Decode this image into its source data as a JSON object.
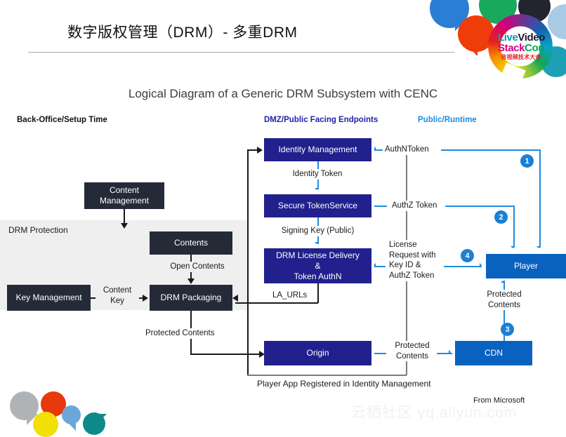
{
  "header": {
    "title": "数字版权管理（DRM）- 多重DRM",
    "bubble_icon": "speech-bubble-icon"
  },
  "logo": {
    "line1_a": "Live",
    "line1_b": "Video",
    "line2_a": "Stack",
    "line2_b": "Con",
    "subtitle": "音视频技术大会"
  },
  "diagram": {
    "title": "Logical Diagram of a Generic DRM Subsystem with CENC",
    "columns": [
      {
        "label": "Back-Office/Setup Time",
        "color": "#111111"
      },
      {
        "label": "DMZ/Public Facing Endpoints",
        "color": "#2222a8"
      },
      {
        "label": "Public/Runtime",
        "color": "#1f8ce0"
      }
    ],
    "panel_label": "DRM Protection",
    "nodes": {
      "content_management": "Content\nManagement",
      "contents": "Contents",
      "key_management": "Key Management",
      "drm_packaging": "DRM Packaging",
      "identity_management": "Identity Management",
      "secure_token_service": "Secure TokenService",
      "drm_license_delivery": "DRM License Delivery\n&\nTokenAuthN",
      "drm_license_delivery_l1": "DRM License Delivery",
      "drm_license_delivery_l2": "&",
      "drm_license_delivery_l3": "Token AuthN",
      "origin": "Origin",
      "cdn": "CDN",
      "player": "Player"
    },
    "edge_labels": {
      "open_contents": "Open Contents",
      "content_key": "Content\nKey",
      "protected_contents_left": "Protected  Contents",
      "identity_token": "Identity Token",
      "signing_key": "Signing Key (Public)",
      "la_urls": "LA_URLs",
      "authn_token": "AuthNToken",
      "authz_token": "AuthZ Token",
      "license_request": "License\nRequest with\nKey ID &\nAuthZ Token",
      "protected_contents_player": "Protected\nContents",
      "protected_contents_cdn": "Protected\nContents"
    },
    "badges": [
      "1",
      "2",
      "3",
      "4"
    ],
    "footnote": "Player App Registered in Identity Management",
    "credit": "From Microsoft"
  },
  "watermark": "云栖社区 yq.aliyun.com",
  "colors": {
    "navy": "#21208c",
    "dark": "#252a38",
    "blue": "#0a62c0",
    "accent_blue": "#1f8ce0",
    "badge": "#1b7fd4",
    "panel": "#efefef"
  }
}
